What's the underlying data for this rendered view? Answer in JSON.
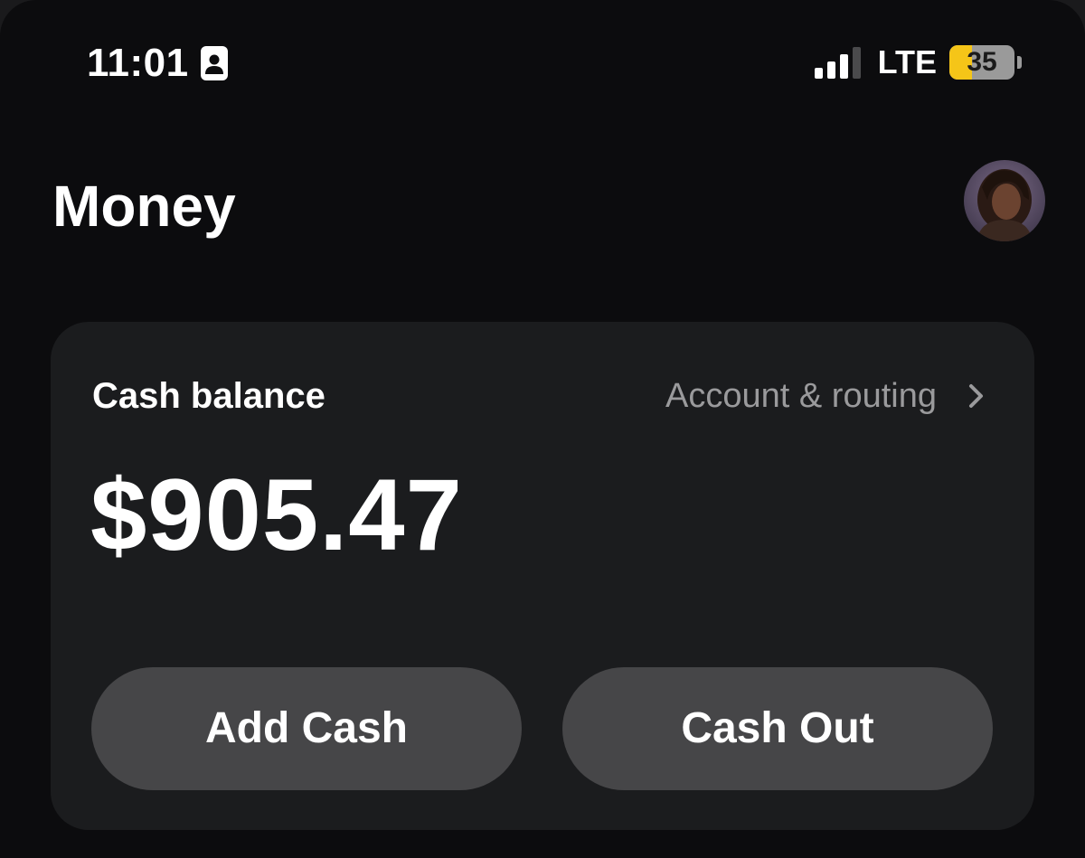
{
  "status_bar": {
    "time": "11:01",
    "focus_icon": "person-card-icon",
    "signal_icon": "cellular-signal-icon",
    "network": "LTE",
    "battery_level": "35",
    "battery_fraction": 0.35,
    "battery_color": "#f5c518"
  },
  "header": {
    "title": "Money",
    "avatar_icon": "profile-avatar"
  },
  "balance_card": {
    "label": "Cash balance",
    "routing_link": "Account & routing",
    "chevron_icon": "chevron-right-icon",
    "amount": "$905.47"
  },
  "actions": {
    "add_cash": "Add Cash",
    "cash_out": "Cash Out"
  },
  "colors": {
    "background": "#0c0c0e",
    "card": "#1b1c1e",
    "button": "#464648",
    "muted_text": "#9a9a9c"
  }
}
